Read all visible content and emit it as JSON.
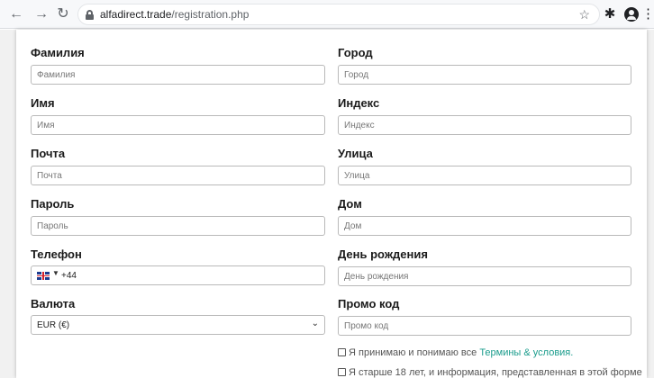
{
  "browser": {
    "url_host": "alfadirect.trade",
    "url_path": "/registration.php",
    "nav_icons": [
      "back-arrow-icon",
      "forward-arrow-icon",
      "reload-icon"
    ]
  },
  "form": {
    "left": {
      "last_name": {
        "label": "Фамилия",
        "placeholder": "Фамилия"
      },
      "first_name": {
        "label": "Имя",
        "placeholder": "Имя"
      },
      "email": {
        "label": "Почта",
        "placeholder": "Почта"
      },
      "password": {
        "label": "Пароль",
        "placeholder": "Пароль"
      },
      "phone": {
        "label": "Телефон",
        "dial_code": "+44",
        "country": "gb"
      },
      "currency": {
        "label": "Валюта",
        "value": "EUR  (€)"
      }
    },
    "right": {
      "city": {
        "label": "Город",
        "placeholder": "Город"
      },
      "zip": {
        "label": "Индекс",
        "placeholder": "Индекс"
      },
      "street": {
        "label": "Улица",
        "placeholder": "Улица"
      },
      "house": {
        "label": "Дом",
        "placeholder": "Дом"
      },
      "birthday": {
        "label": "День рождения",
        "placeholder": "День рождения"
      },
      "promo": {
        "label": "Промо код",
        "placeholder": "Промо код"
      }
    },
    "terms": {
      "text": "Я принимаю и понимаю все ",
      "link": "Термины & условия."
    },
    "age": {
      "text": "Я старше 18 лет, и информация, представленная в этой форме"
    }
  },
  "colors": {
    "link": "#1a9c8c",
    "chrome_bg": "#f7f8fa"
  }
}
